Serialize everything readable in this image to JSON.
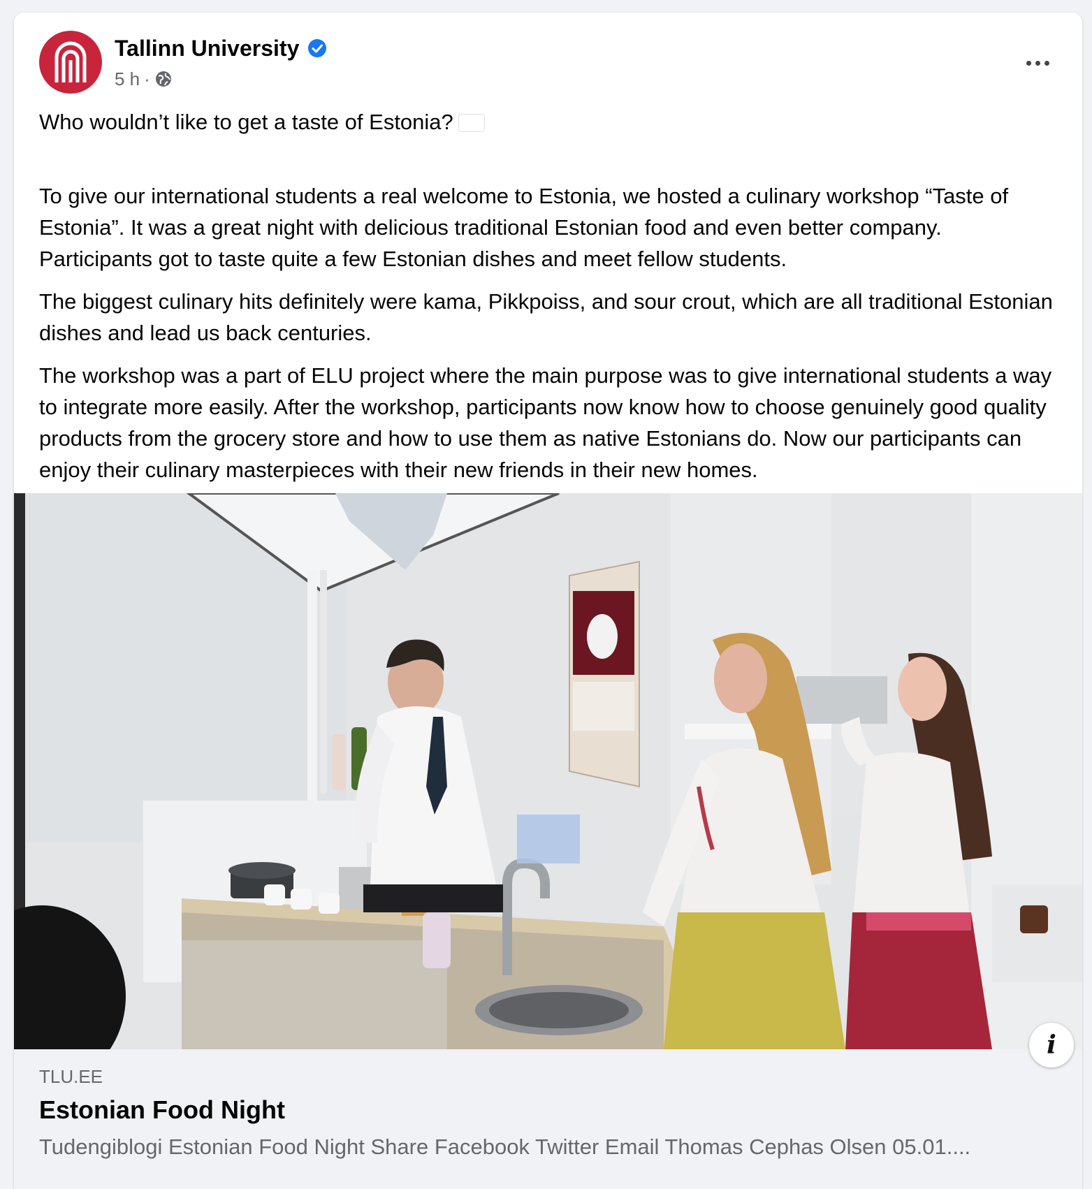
{
  "post": {
    "page_name": "Tallinn University",
    "time": "5 h",
    "separator": "·",
    "verified_icon": "verified-badge-icon",
    "privacy_icon": "globe-icon",
    "more_icon": "more-horizontal-icon",
    "text": {
      "p1_line1": "Who wouldn’t like to get a taste of Estonia?",
      "p1_rest": "To give our international students a real welcome to Estonia, we hosted a culinary workshop “Taste of Estonia”. It was a great night with delicious traditional Estonian food and even better company. Participants got to taste quite a few Estonian dishes and meet fellow students.",
      "p2": "The biggest culinary hits definitely were kama, Pikkpoiss, and sour crout, which are all traditional Estonian dishes and lead us back centuries.",
      "p3": "The workshop was a part of ELU project where the main purpose was to give international students a way to integrate more easily. After the workshop, participants now know how to choose genuinely good quality products from the grocery store and how to use them as native Estonians do.  Now our participants can enjoy their culinary masterpieces with their new friends in their new homes."
    },
    "flag_colors": [
      "#0072ce",
      "#000000",
      "#ffffff"
    ]
  },
  "link_preview": {
    "domain": "TLU.EE",
    "title": "Estonian Food Night",
    "description": "Tudengiblogi Estonian Food Night Share Facebook Twitter Email Thomas Cephas Olsen 05.01....",
    "info_label": "i"
  },
  "colors": {
    "brand": "#c8243c",
    "verified": "#1877f2",
    "secondary_text": "#65676b"
  }
}
